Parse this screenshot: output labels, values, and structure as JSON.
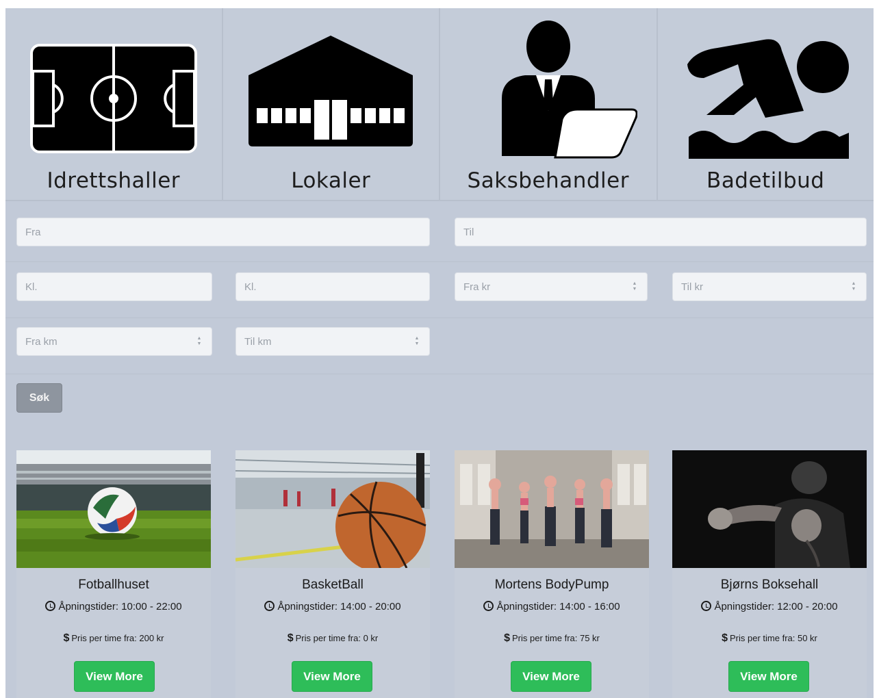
{
  "categories": [
    {
      "label": "Idrettshaller",
      "icon": "football-field-icon"
    },
    {
      "label": "Lokaler",
      "icon": "building-icon"
    },
    {
      "label": "Saksbehandler",
      "icon": "person-laptop-icon"
    },
    {
      "label": "Badetilbud",
      "icon": "swimmer-icon"
    }
  ],
  "filters": {
    "from_date_placeholder": "Fra",
    "to_date_placeholder": "Til",
    "from_time_placeholder": "Kl.",
    "to_time_placeholder": "Kl.",
    "price_from_placeholder": "Fra kr",
    "price_to_placeholder": "Til kr",
    "distance_from_placeholder": "Fra km",
    "distance_to_placeholder": "Til km",
    "search_label": "Søk"
  },
  "venues": [
    {
      "name": "Fotballhuset",
      "hours": "Åpningstider: 10:00 - 22:00",
      "price": "Pris per time fra: 200 kr",
      "button": "View More"
    },
    {
      "name": "BasketBall",
      "hours": "Åpningstider: 14:00 - 20:00",
      "price": "Pris per time fra: 0 kr",
      "button": "View More"
    },
    {
      "name": "Mortens BodyPump",
      "hours": "Åpningstider: 14:00 - 16:00",
      "price": "Pris per time fra: 75 kr",
      "button": "View More"
    },
    {
      "name": "Bjørns Boksehall",
      "hours": "Åpningstider: 12:00 - 20:00",
      "price": "Pris per time fra: 50 kr",
      "button": "View More"
    }
  ],
  "colors": {
    "background": "#c2cad8",
    "input": "#f1f3f6",
    "search_button": "#8e959f",
    "view_button": "#2ebd59"
  }
}
